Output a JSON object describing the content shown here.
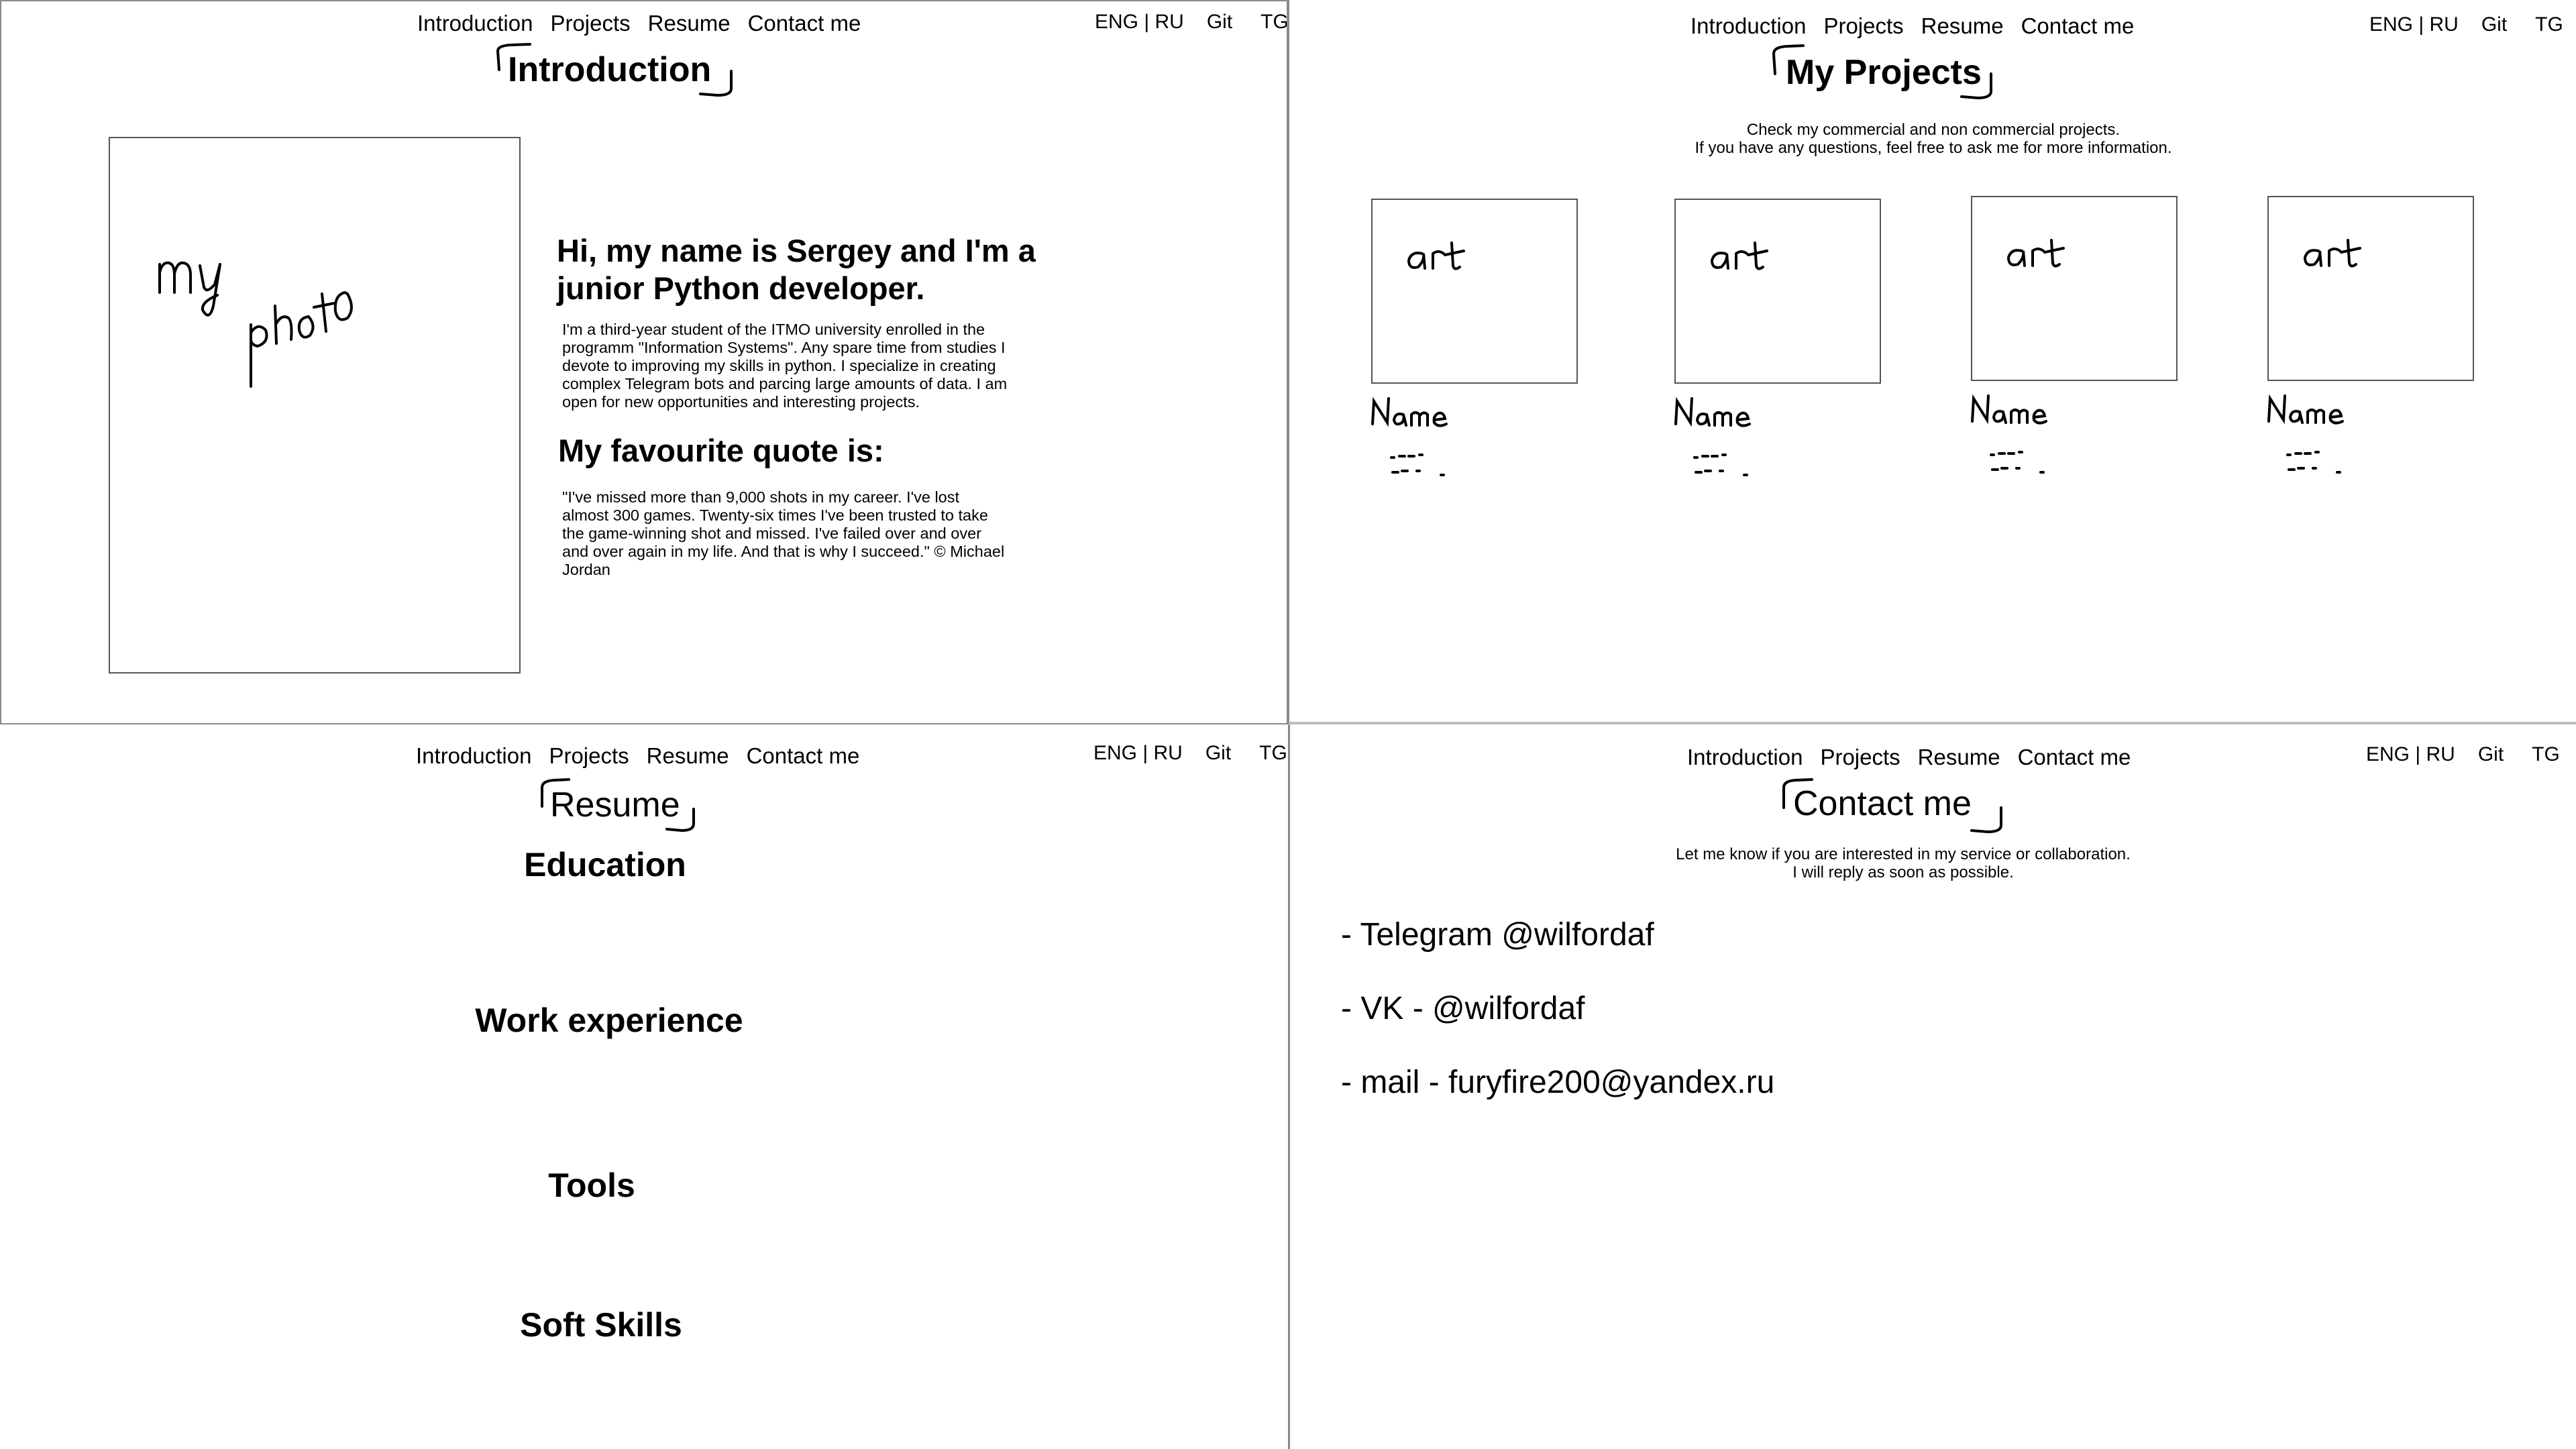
{
  "nav": [
    "Introduction",
    "Projects",
    "Resume",
    "Contact me"
  ],
  "util": {
    "lang": "ENG | RU",
    "git": "Git",
    "tg": "TG"
  },
  "intro": {
    "title": "Introduction",
    "photo_placeholder": [
      "my",
      "photo"
    ],
    "greeting": "Hi, my name is Sergey and I'm a junior Python developer.",
    "about": "I'm a third-year student of the ITMO university enrolled in the programm \"Information Systems\". Any spare time from studies I devote to improving my skills in python. I specialize in creating complex Telegram bots and parcing large amounts of data. I am open for new opportunities and interesting projects.",
    "quote_heading": "My favourite quote is:",
    "quote": "\"I've missed more than 9,000 shots in my career. I've lost almost 300 games. Twenty-six times I've been trusted to take the game-winning shot and missed. I've failed over and over and over again in my life. And that is why I succeed.\" © Michael Jordan"
  },
  "projects": {
    "title": "My Projects",
    "subtitle_line1": "Check my commercial and non commercial projects.",
    "subtitle_line2": "If you have any questions, feel free to ask me for more information.",
    "cards": [
      {
        "art": "art",
        "name": "Name"
      },
      {
        "art": "art",
        "name": "Name"
      },
      {
        "art": "art",
        "name": "Name"
      },
      {
        "art": "art",
        "name": "Name"
      }
    ]
  },
  "resume": {
    "title": "Resume",
    "sections": [
      "Education",
      "Work experience",
      "Tools",
      "Soft Skills"
    ]
  },
  "contact": {
    "title": "Contact me",
    "subtitle_line1": "Let me know if you are interested in my service or collaboration.",
    "subtitle_line2": "I will reply as soon as possible.",
    "items": [
      "- Telegram @wilfordaf",
      "- VK - @wilfordaf",
      "- mail - furyfire200@yandex.ru"
    ]
  }
}
